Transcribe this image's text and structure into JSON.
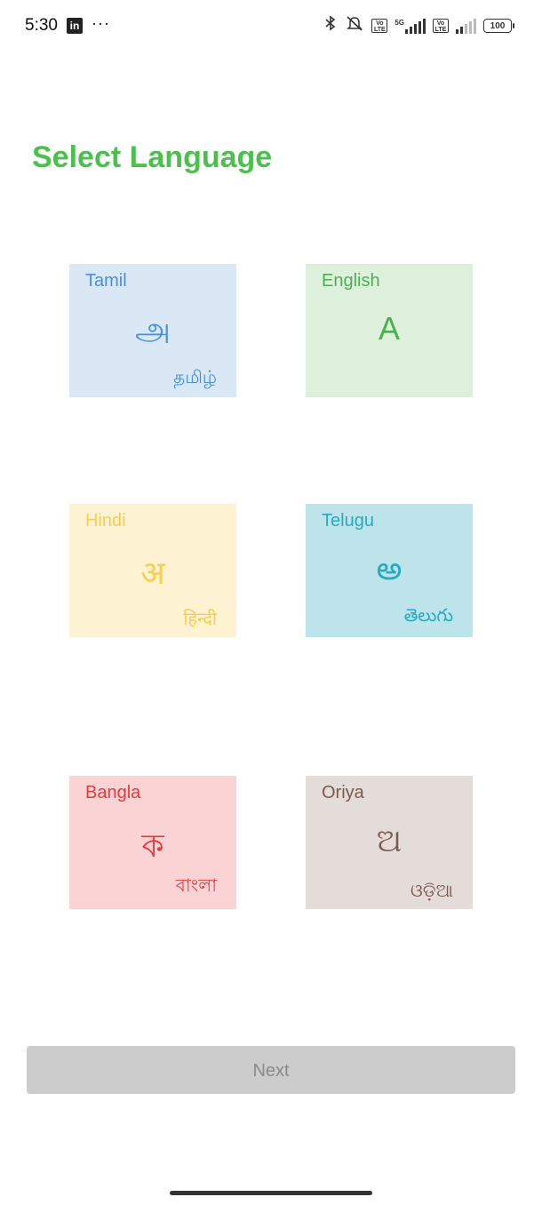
{
  "status_bar": {
    "time": "5:30",
    "linkedin_icon_text": "in",
    "overflow_dots": "···",
    "network_5g": "5G",
    "volte_label": "Vo LTE",
    "battery": "100"
  },
  "page": {
    "title": "Select Language"
  },
  "languages": [
    {
      "name": "Tamil",
      "glyph": "அ",
      "native": "தமிழ்",
      "color": "#4a90d6",
      "bg": "#dae8f6"
    },
    {
      "name": "English",
      "glyph": "A",
      "native": "",
      "color": "#4cb050",
      "bg": "#dcf0dc"
    },
    {
      "name": "Hindi",
      "glyph": "अ",
      "native": "हिन्दी",
      "color": "#f6cf55",
      "bg": "#fdf2d2"
    },
    {
      "name": "Telugu",
      "glyph": "అ",
      "native": "తెలుగు",
      "color": "#27aabf",
      "bg": "#bce4ea"
    },
    {
      "name": "Bangla",
      "glyph": "ক",
      "native": "বাংলা",
      "color": "#e53a3a",
      "bg": "#fad4d4"
    },
    {
      "name": "Oriya",
      "glyph": "ଅ",
      "native": "ଓଡ଼ିଆ",
      "color": "#7a5a50",
      "bg": "#e4dcd9"
    }
  ],
  "footer": {
    "next_label": "Next"
  },
  "colors": {
    "title": "#4cc04f",
    "next_button_bg": "#cccccc",
    "next_button_text": "#8a8a8a"
  }
}
